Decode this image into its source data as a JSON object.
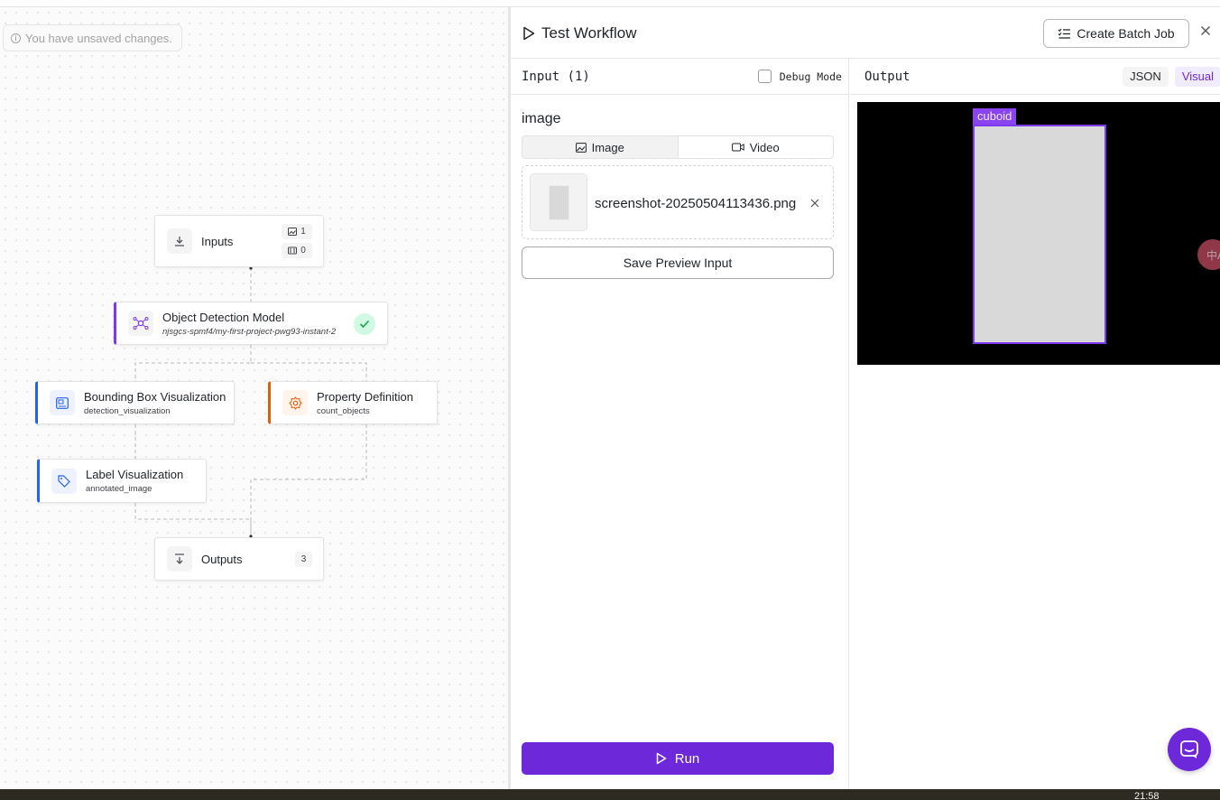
{
  "canvas": {
    "unsaved_notice": "You have unsaved changes.",
    "nodes": {
      "inputs": {
        "title": "Inputs",
        "image_count": "1",
        "video_count": "0"
      },
      "object_detection": {
        "title": "Object Detection Model",
        "subtitle": "njsgcs-spmf4/my-first-project-pwg93-instant-2"
      },
      "bounding_box": {
        "title": "Bounding Box Visualization",
        "subtitle": "detection_visualization"
      },
      "property_definition": {
        "title": "Property Definition",
        "subtitle": "count_objects"
      },
      "label_visualization": {
        "title": "Label Visualization",
        "subtitle": "annotated_image"
      },
      "outputs": {
        "title": "Outputs",
        "count": "3"
      }
    }
  },
  "panel": {
    "title": "Test Workflow",
    "create_batch_label": "Create Batch Job",
    "input": {
      "header": "Input (1)",
      "debug_label": "Debug Mode",
      "field_label": "image",
      "tabs": [
        {
          "label": "Image",
          "icon": "image-icon"
        },
        {
          "label": "Video",
          "icon": "video-icon"
        }
      ],
      "file_name": "screenshot-20250504113436.png",
      "save_preview_label": "Save Preview Input",
      "run_label": "Run"
    },
    "output": {
      "header": "Output",
      "view_json": "JSON",
      "view_visual": "Visual",
      "detection_label": "cuboid",
      "translate_glyph": "中A"
    }
  },
  "colors": {
    "accent": "#6d28d9",
    "blue": "#2563eb",
    "orange": "#ea580c",
    "success": "#16a34a"
  },
  "system": {
    "clock": "21:58"
  }
}
